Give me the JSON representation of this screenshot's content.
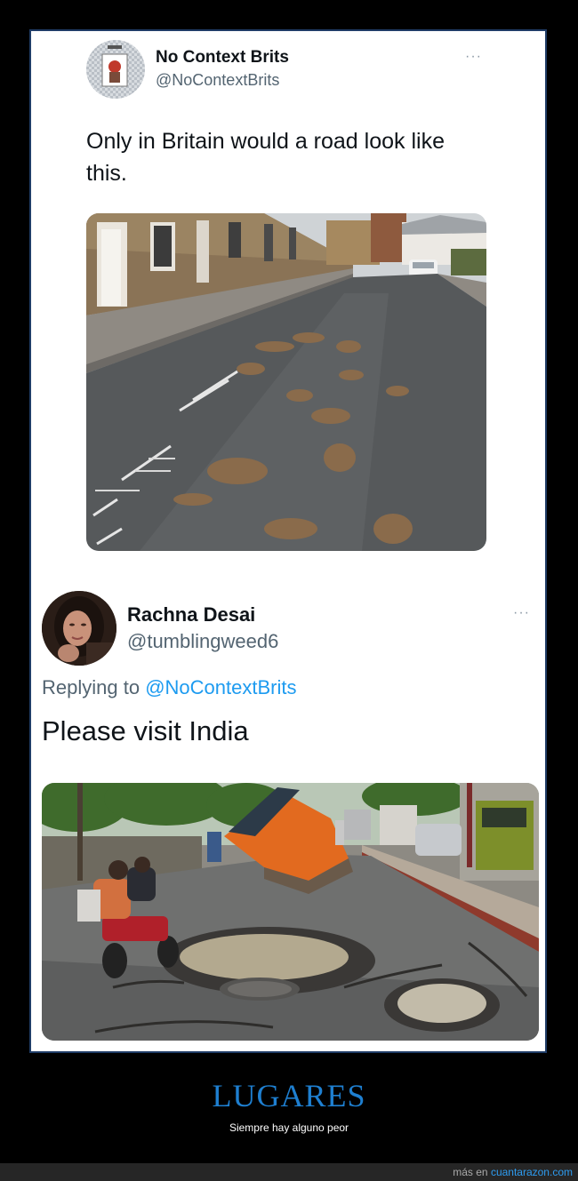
{
  "tweet1": {
    "name": "No Context Brits",
    "handle": "@NoContextBrits",
    "text_line1": "Only in Britain would a road look like",
    "text_line2": "this.",
    "more": "···"
  },
  "tweet2": {
    "name": "Rachna Desai",
    "handle": "@tumblingweed6",
    "replying_prefix": "Replying to ",
    "replying_handle": "@NoContextBrits",
    "text": "Please visit India",
    "more": "···"
  },
  "footer": {
    "title": "LUGARES",
    "subtitle": "Siempre hay alguno peor",
    "credit_prefix": "más en ",
    "credit_site": "cuantarazon.com"
  },
  "colors": {
    "link": "#1d9bf0",
    "footer_title": "#1e7fd0",
    "frame": "#1f3c66"
  }
}
